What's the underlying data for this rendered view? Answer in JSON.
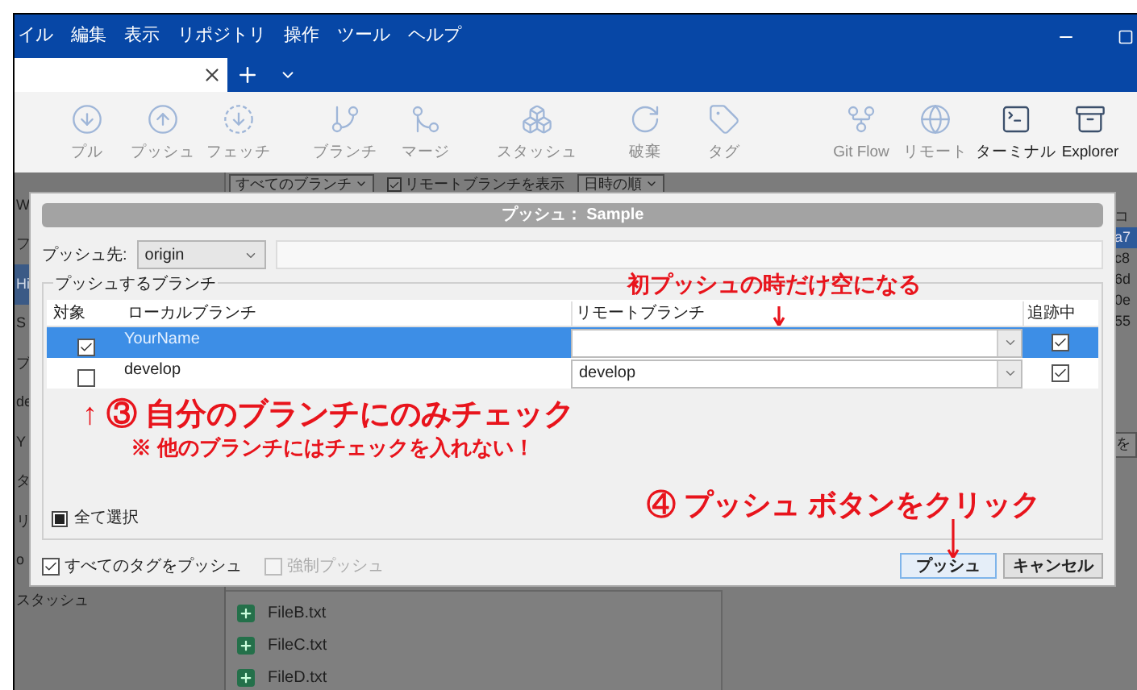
{
  "menu": [
    "イル",
    "編集",
    "表示",
    "リポジトリ",
    "操作",
    "ツール",
    "ヘルプ"
  ],
  "toolbar": [
    {
      "label": "プル",
      "disabled": true
    },
    {
      "label": "プッシュ",
      "disabled": true
    },
    {
      "label": "フェッチ",
      "disabled": true
    },
    {
      "label": "ブランチ",
      "disabled": true
    },
    {
      "label": "マージ",
      "disabled": true
    },
    {
      "label": "スタッシュ",
      "disabled": true
    },
    {
      "label": "破棄",
      "disabled": true
    },
    {
      "label": "タグ",
      "disabled": true
    },
    {
      "label": "Git Flow",
      "disabled": true
    },
    {
      "label": "リモート",
      "disabled": true
    },
    {
      "label": "ターミナル",
      "disabled": false
    },
    {
      "label": "Explorer",
      "disabled": false
    }
  ],
  "filter_bar": {
    "branches": "すべてのブランチ",
    "show_remote": {
      "label": "リモートブランチを表示",
      "checked": true
    },
    "sort": "日時の順"
  },
  "sidebar_fragments": [
    {
      "text": "W",
      "selected": false
    },
    {
      "text": "フ",
      "selected": false
    },
    {
      "text": "Hi",
      "selected": true
    },
    {
      "text": "S",
      "selected": false
    },
    {
      "text": "ブ",
      "selected": false
    },
    {
      "text": "de",
      "selected": false
    },
    {
      "text": "Y",
      "selected": false
    },
    {
      "text": "タ",
      "selected": false
    },
    {
      "text": "リ",
      "selected": false
    },
    {
      "text": "o",
      "selected": false
    },
    {
      "text": "スタッシュ",
      "selected": false
    }
  ],
  "commit_fragments": [
    {
      "text": "コ",
      "selected": false
    },
    {
      "text": "a7",
      "selected": true
    },
    {
      "text": "c8",
      "selected": false
    },
    {
      "text": "6d",
      "selected": false
    },
    {
      "text": "0e",
      "selected": false
    },
    {
      "text": "55",
      "selected": false
    }
  ],
  "side_button": "を",
  "files": [
    "FileB.txt",
    "FileC.txt",
    "FileD.txt"
  ],
  "dialog": {
    "title": "プッシュ： Sample",
    "push_to_label": "プッシュ先:",
    "remote": "origin",
    "group_label": "プッシュするブランチ",
    "columns": [
      "対象",
      "ローカルブランチ",
      "リモートブランチ",
      "追跡中"
    ],
    "rows": [
      {
        "checked": true,
        "local": "YourName",
        "tracking": true,
        "selected": true
      },
      {
        "checked": false,
        "local": "develop",
        "remote": "develop",
        "tracking": true,
        "selected": false
      }
    ],
    "select_all": {
      "label": "全て選択",
      "indeterminate": true
    },
    "options": [
      {
        "label": "すべてのタグをプッシュ",
        "checked": true,
        "disabled": false
      },
      {
        "label": "強制プッシュ",
        "checked": false,
        "disabled": true
      }
    ],
    "buttons": [
      {
        "label": "プッシュ",
        "kind": "primary"
      },
      {
        "label": "キャンセル",
        "kind": "normal"
      }
    ]
  },
  "annotations": [
    "初プッシュの時だけ空になる",
    "↑ ③ 自分のブランチにのみチェック",
    "※ 他のブランチにはチェックを入れない！",
    "④ プッシュ ボタンをクリック"
  ]
}
